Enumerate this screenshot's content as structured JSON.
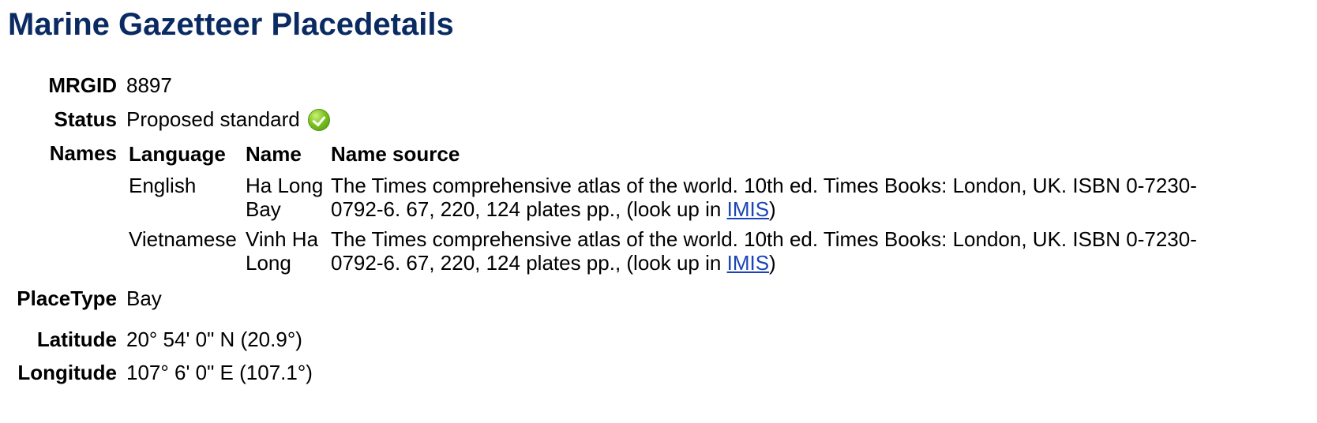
{
  "page_title": "Marine Gazetteer Placedetails",
  "fields": {
    "mrgid": {
      "label": "MRGID",
      "value": "8897"
    },
    "status": {
      "label": "Status",
      "value": "Proposed standard",
      "icon": "check-circle-icon",
      "icon_color": "#7cc41d"
    },
    "names": {
      "label": "Names"
    },
    "placetype": {
      "label": "PlaceType",
      "value": "Bay"
    },
    "latitude": {
      "label": "Latitude",
      "value": "20° 54' 0\" N (20.9°)"
    },
    "longitude": {
      "label": "Longitude",
      "value": "107° 6' 0\" E (107.1°)"
    }
  },
  "names_table": {
    "headers": [
      "Language",
      "Name",
      "Name source"
    ],
    "rows": [
      {
        "language": "English",
        "name": "Ha Long Bay",
        "source_text": "The Times comprehensive atlas of the world. 10th ed. Times Books: London, UK. ISBN 0-7230-0792-6. 67, 220, 124 plates pp., (look up in ",
        "link_text": "IMIS",
        "source_end": ")"
      },
      {
        "language": "Vietnamese",
        "name": "Vinh Ha Long",
        "source_text": "The Times comprehensive atlas of the world. 10th ed. Times Books: London, UK. ISBN 0-7230-0792-6. 67, 220, 124 plates pp., (look up in ",
        "link_text": "IMIS",
        "source_end": ")"
      }
    ]
  },
  "colors": {
    "title": "#0a2b62",
    "link": "#1a44b8"
  }
}
